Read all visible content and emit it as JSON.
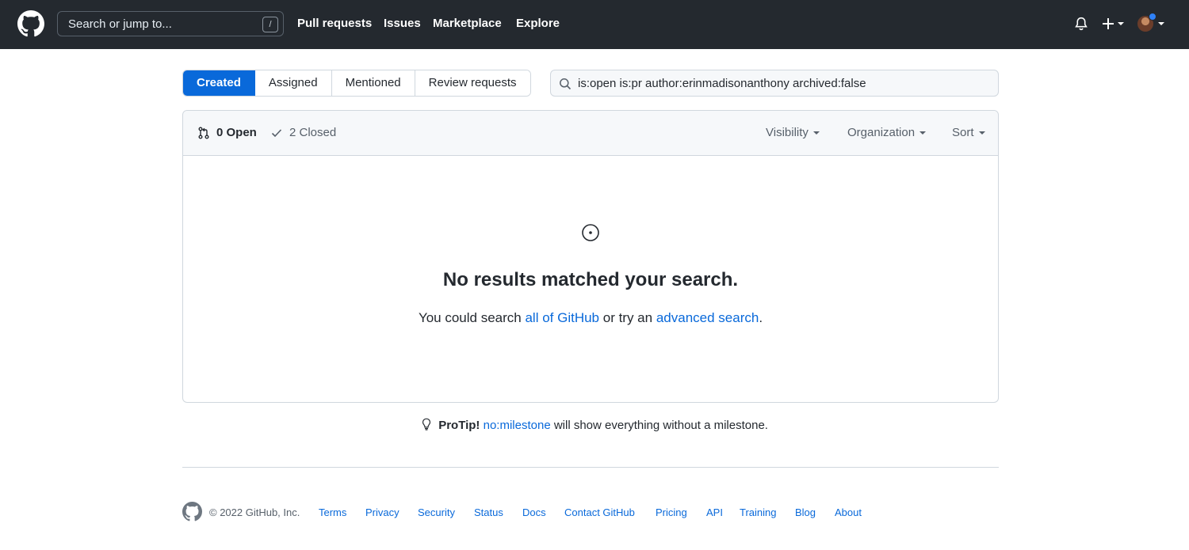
{
  "header": {
    "search_placeholder": "Search or jump to...",
    "search_shortcut": "/",
    "nav": [
      "Pull requests",
      "Issues",
      "Marketplace",
      "Explore"
    ]
  },
  "tabs": [
    {
      "label": "Created",
      "selected": true
    },
    {
      "label": "Assigned",
      "selected": false
    },
    {
      "label": "Mentioned",
      "selected": false
    },
    {
      "label": "Review requests",
      "selected": false
    }
  ],
  "filter_query": "is:open is:pr author:erinmadisonanthony archived:false",
  "box_header": {
    "open_label": "0 Open",
    "closed_label": "2 Closed",
    "visibility_label": "Visibility",
    "organization_label": "Organization",
    "sort_label": "Sort"
  },
  "blankslate": {
    "title": "No results matched your search.",
    "text_prefix": "You could search ",
    "link_all": "all of GitHub",
    "text_mid": " or try an ",
    "link_advanced": "advanced search",
    "text_suffix": "."
  },
  "protip": {
    "label": "ProTip!",
    "link": "no:milestone",
    "text": " will show everything without a milestone."
  },
  "footer": {
    "copyright": "© 2022 GitHub, Inc.",
    "links": [
      "Terms",
      "Privacy",
      "Security",
      "Status",
      "Docs",
      "Contact GitHub",
      "Pricing",
      "API",
      "Training",
      "Blog",
      "About"
    ]
  },
  "colors": {
    "header_bg": "#24292f",
    "accent": "#0969da",
    "notification_dot": "#2f81f7"
  },
  "icons": [
    "github-logo-icon",
    "bell-icon",
    "plus-icon",
    "search-icon",
    "pull-request-icon",
    "check-icon",
    "issue-circle-icon",
    "light-bulb-icon"
  ]
}
